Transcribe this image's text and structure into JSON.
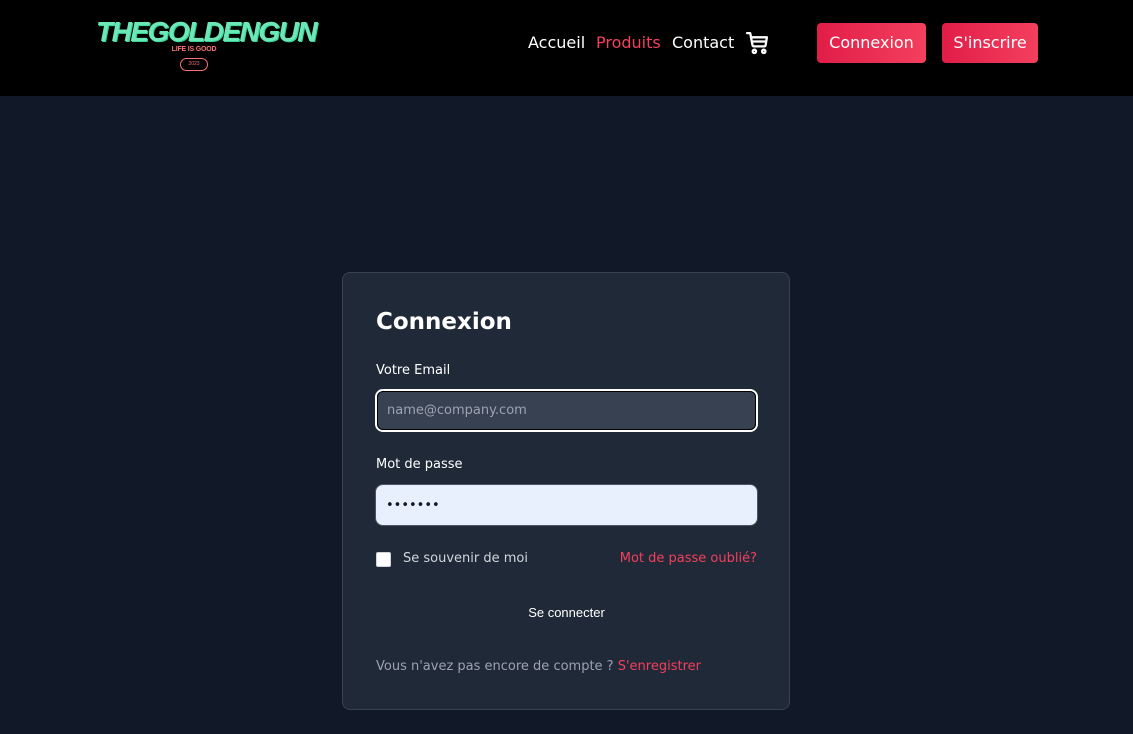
{
  "header": {
    "logo": {
      "title": "THEGOLDENGUN",
      "subtitle": "LIFE IS GOOD",
      "year": "2023"
    },
    "nav": {
      "home": "Accueil",
      "products": "Produits",
      "contact": "Contact"
    },
    "cart_icon": "shopping-cart-icon",
    "login_button": "Connexion",
    "signup_button": "S'inscrire"
  },
  "login_form": {
    "title": "Connexion",
    "email_label": "Votre Email",
    "email_placeholder": "name@company.com",
    "email_value": "",
    "password_label": "Mot de passe",
    "password_value": "•••••••",
    "remember_label": "Se souvenir de moi",
    "remember_checked": false,
    "forgot_link": "Mot de passe oublié?",
    "submit_label": "Se connecter",
    "no_account_text": "Vous n'avez pas encore de compte ?",
    "register_link": "S'enregistrer"
  },
  "colors": {
    "accent": "#f43f5e",
    "logo": "#6ee7b7",
    "page_background": "#111827",
    "card_background": "#1f2937",
    "header_background": "#000000"
  }
}
